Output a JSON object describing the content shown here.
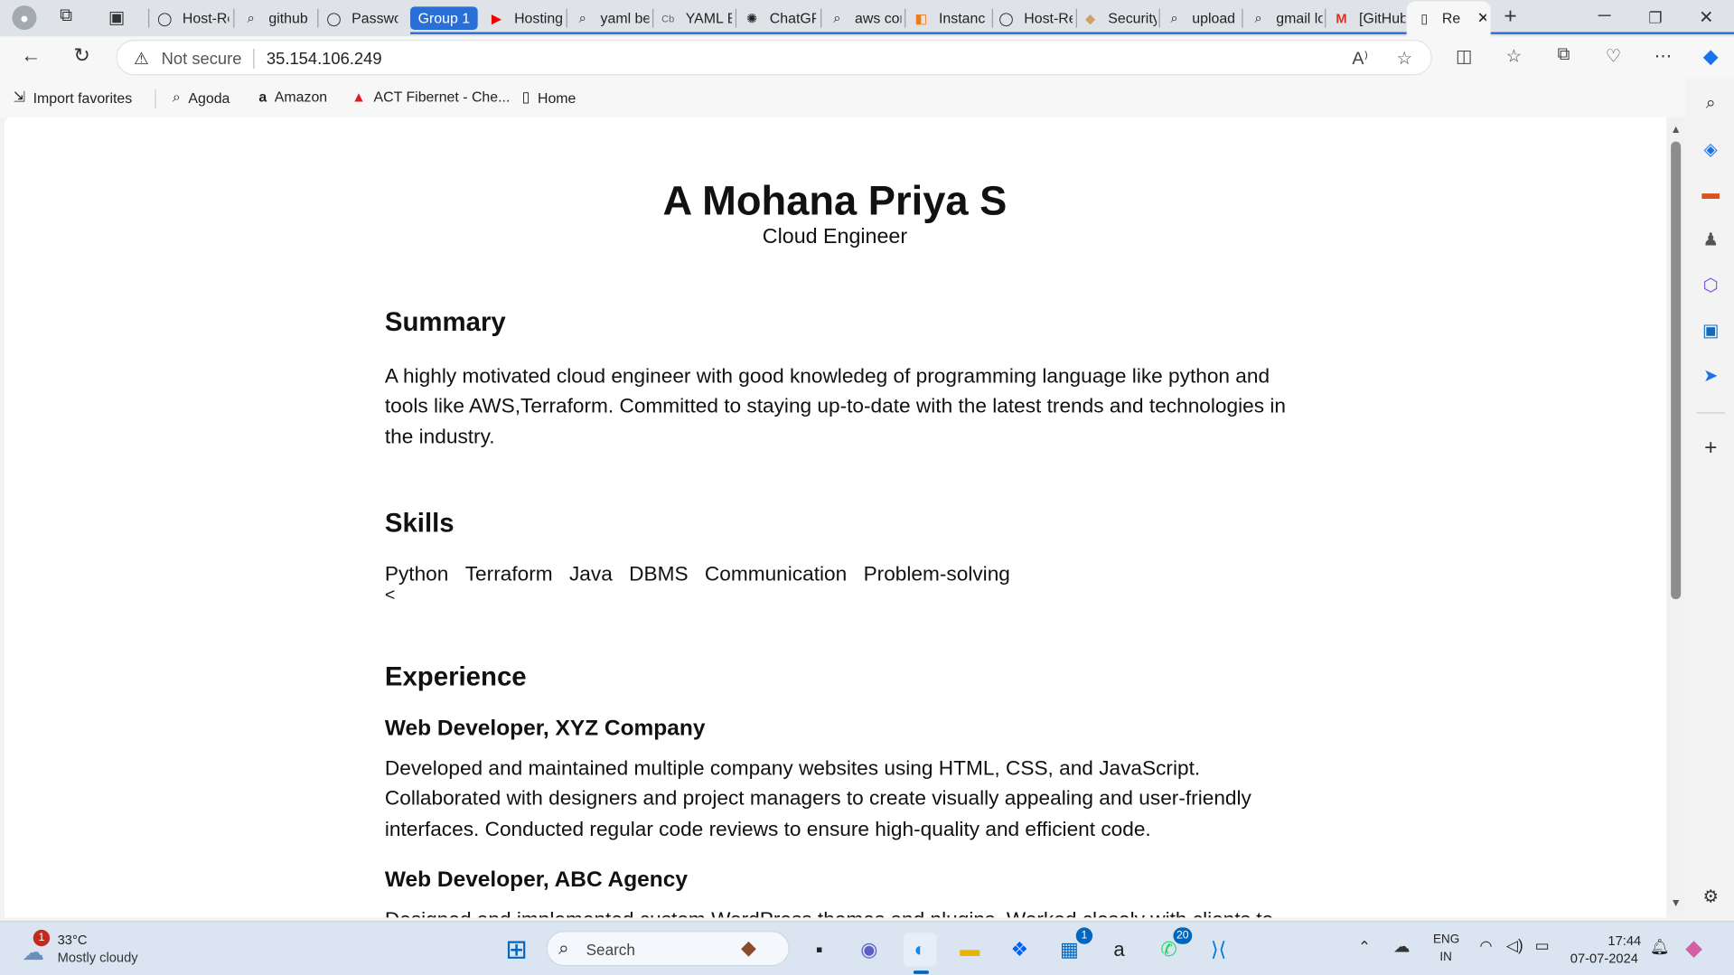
{
  "browser": {
    "tabs": [
      {
        "label": "Host-Re",
        "icon": "github-icon",
        "glyph": "◯"
      },
      {
        "label": "github",
        "icon": "search-icon",
        "glyph": "⌕"
      },
      {
        "label": "Passwo",
        "icon": "github-icon",
        "glyph": "◯"
      },
      {
        "label": "Hosting",
        "icon": "youtube-icon",
        "glyph": "▶"
      },
      {
        "label": "yaml be",
        "icon": "search-icon",
        "glyph": "⌕"
      },
      {
        "label": "YAML B",
        "icon": "cb-icon",
        "glyph": "Cb"
      },
      {
        "label": "ChatGP",
        "icon": "chatgpt-icon",
        "glyph": "✺"
      },
      {
        "label": "aws cor",
        "icon": "search-icon",
        "glyph": "⌕"
      },
      {
        "label": "Instanc",
        "icon": "aws-icon",
        "glyph": "◧"
      },
      {
        "label": "Host-Re",
        "icon": "github-icon",
        "glyph": "◯"
      },
      {
        "label": "Security",
        "icon": "box-icon",
        "glyph": "◆"
      },
      {
        "label": "upload",
        "icon": "search-icon",
        "glyph": "⌕"
      },
      {
        "label": "gmail lo",
        "icon": "search-icon",
        "glyph": "⌕"
      },
      {
        "label": "[GitHub",
        "icon": "gmail-icon",
        "glyph": "M"
      },
      {
        "label": "Re",
        "icon": "page-icon",
        "glyph": "▯"
      }
    ],
    "group_label": "Group 1",
    "address": {
      "security_label": "Not secure",
      "url": "35.154.106.249"
    },
    "favorites": [
      {
        "label": "Import favorites",
        "icon": "import-icon",
        "glyph": "⇲"
      },
      {
        "label": "Agoda",
        "icon": "search-icon",
        "glyph": "⌕"
      },
      {
        "label": "Amazon",
        "icon": "amazon-icon",
        "glyph": "a"
      },
      {
        "label": "ACT Fibernet - Che...",
        "icon": "act-icon",
        "glyph": "▲"
      },
      {
        "label": "Home",
        "icon": "page-icon",
        "glyph": "▯"
      }
    ]
  },
  "resume": {
    "name": "A Mohana Priya S",
    "role": "Cloud Engineer",
    "summary_heading": "Summary",
    "summary_text": "A highly motivated cloud engineer with good knowledeg of programming language like python and tools like AWS,Terraform. Committed to staying up-to-date with the latest trends and technologies in the industry.",
    "skills_heading": "Skills",
    "skills": [
      "Python",
      "Terraform",
      "Java",
      "DBMS",
      "Communication",
      "Problem-solving"
    ],
    "stray_char": "<",
    "experience_heading": "Experience",
    "jobs": [
      {
        "title": "Web Developer, XYZ Company",
        "description": "Developed and maintained multiple company websites using HTML, CSS, and JavaScript. Collaborated with designers and project managers to create visually appealing and user-friendly interfaces. Conducted regular code reviews to ensure high-quality and efficient code."
      },
      {
        "title": "Web Developer, ABC Agency",
        "description": "Designed and implemented custom WordPress themes and plugins. Worked closely with clients to"
      }
    ]
  },
  "taskbar": {
    "weather_temp": "33°C",
    "weather_desc": "Mostly cloudy",
    "weather_badge": "1",
    "search_placeholder": "Search",
    "store_badge": "1",
    "whatsapp_badge": "20",
    "lang_top": "ENG",
    "lang_bottom": "IN",
    "time": "17:44",
    "date": "07-07-2024"
  },
  "colors": {
    "accent": "#2a6fd6",
    "taskbar": "#dbe5f1",
    "badge_red": "#c42b1c",
    "badge_blue": "#0067c0"
  }
}
